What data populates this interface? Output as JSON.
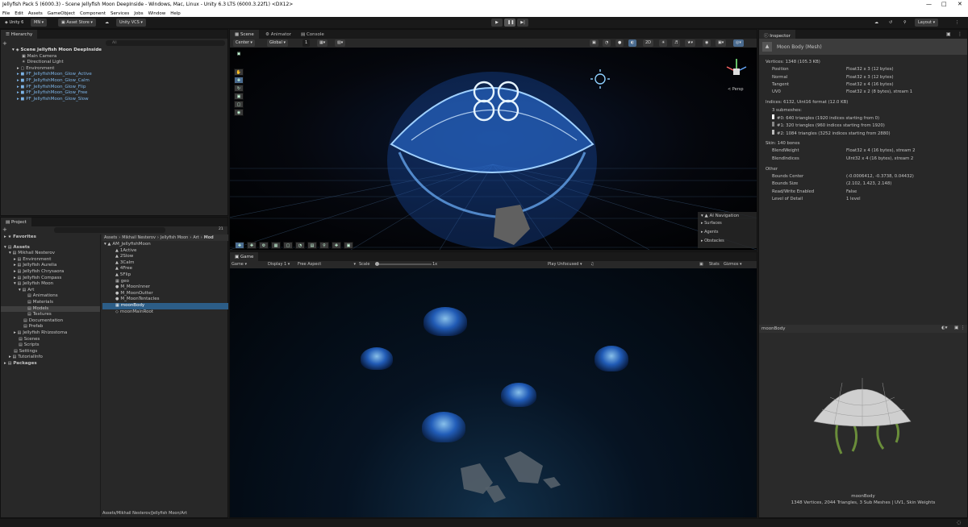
{
  "window": {
    "title": "Jellyfish Pack 5 (6000.3) - Scene Jellyfish Moon DeepInside - Windows, Mac, Linux - Unity 6.3 LTS (6000.3.22f1) <DX12>"
  },
  "menu": [
    "File",
    "Edit",
    "Assets",
    "GameObject",
    "Component",
    "Services",
    "Jobs",
    "Window",
    "Help"
  ],
  "toolbar": {
    "unity": "Unity 6",
    "account": "MN",
    "asset_store": "Asset Store",
    "vcs": "Unity VCS",
    "layout": "Layout"
  },
  "hierarchy": {
    "tab": "Hierarchy",
    "search_placeholder": "All",
    "scene": "Scene Jellyfish Moon DeepInside",
    "items": [
      "Main Camera",
      "Directional Light",
      "Environment"
    ],
    "prefabs": [
      "PF_JellyfishMoon_Glow_Active",
      "PF_JellyfishMoon_Glow_Calm",
      "PF_JellyfishMoon_Glow_Flip",
      "PF_JellyfishMoon_Glow_Free",
      "PF_JellyfishMoon_Glow_Slow"
    ]
  },
  "project": {
    "tab": "Project",
    "count": "21",
    "favorites": "Favorites",
    "tree": [
      "Assets",
      "Mikhail Nesterov",
      "Environment",
      "Jellyfish Aurelia",
      "Jellyfish Chrysaora",
      "Jellyfish Compass",
      "Jellyfish Moon",
      "Art",
      "Animations",
      "Materials",
      "Models",
      "Textures",
      "Documentation",
      "Prefab",
      "Jellyfish Rhizostoma",
      "Scenes",
      "Scripts",
      "Settings",
      "TutorialInfo",
      "Packages"
    ],
    "breadcrumb": [
      "Assets",
      "Mikhail Nesterov",
      "Jellyfish Moon",
      "Art",
      "Mod"
    ],
    "files": [
      "AM_JellyfishMoon",
      "1Active",
      "2Slow",
      "3Calm",
      "4Free",
      "5Flip",
      "geo",
      "M_MoonInner",
      "M_MoonOutter",
      "M_MoonTentacles",
      "moonBody",
      "moonMainRoot"
    ],
    "path": "Assets/Mikhail Nesterov/Jellyfish Moon/Art"
  },
  "scene": {
    "tabs": [
      "Scene",
      "Animator",
      "Console"
    ],
    "pivot": "Center",
    "space": "Global",
    "snap": "1",
    "persp": "< Persp",
    "ai_nav": {
      "title": "AI Navigation",
      "items": [
        "Surfaces",
        "Agents",
        "Obstacles"
      ]
    }
  },
  "game": {
    "tab": "Game",
    "mode": "Game",
    "display": "Display 1",
    "aspect": "Free Aspect",
    "scale_label": "Scale",
    "scale": "1x",
    "play": "Play Unfocused",
    "stats": "Stats",
    "gizmos": "Gizmos"
  },
  "inspector": {
    "tab": "Inspector",
    "title": "Moon Body (Mesh)",
    "vertices": "Vertices: 1348 (105.3 KB)",
    "vattrs": [
      [
        "Position",
        "Float32 x 3 (12 bytes)"
      ],
      [
        "Normal",
        "Float32 x 3 (12 bytes)"
      ],
      [
        "Tangent",
        "Float32 x 4 (16 bytes)"
      ],
      [
        "UV0",
        "Float32 x 2 (8 bytes), stream 1"
      ]
    ],
    "indices": "Indices: 6132, Uint16 format (12.0 KB)",
    "submeshes": "3 submeshes:",
    "subs": [
      "#0: 640 triangles (1920 indices starting from 0)",
      "#1: 320 triangles (960 indices starting from 1920)",
      "#2: 1084 triangles (3252 indices starting from 2880)"
    ],
    "skin": "Skin: 140 bones",
    "sattrs": [
      [
        "BlendWeight",
        "Float32 x 4 (16 bytes), stream 2"
      ],
      [
        "BlendIndices",
        "UInt32 x 4 (16 bytes), stream 2"
      ]
    ],
    "other": "Other",
    "oattrs": [
      [
        "Bounds Center",
        "(-0.0006412, -0.3738, 0.04432)"
      ],
      [
        "Bounds Size",
        "(2.102, 1.423, 2.148)"
      ],
      [
        "Read/Write Enabled",
        "False"
      ],
      [
        "Level of Detail",
        "1 level"
      ]
    ],
    "preview_name": "moonBody",
    "preview_caption": "moonBody",
    "preview_stats": "1348 Vertices, 2044 Triangles, 3 Sub Meshes | UV1, Skin Weights"
  }
}
